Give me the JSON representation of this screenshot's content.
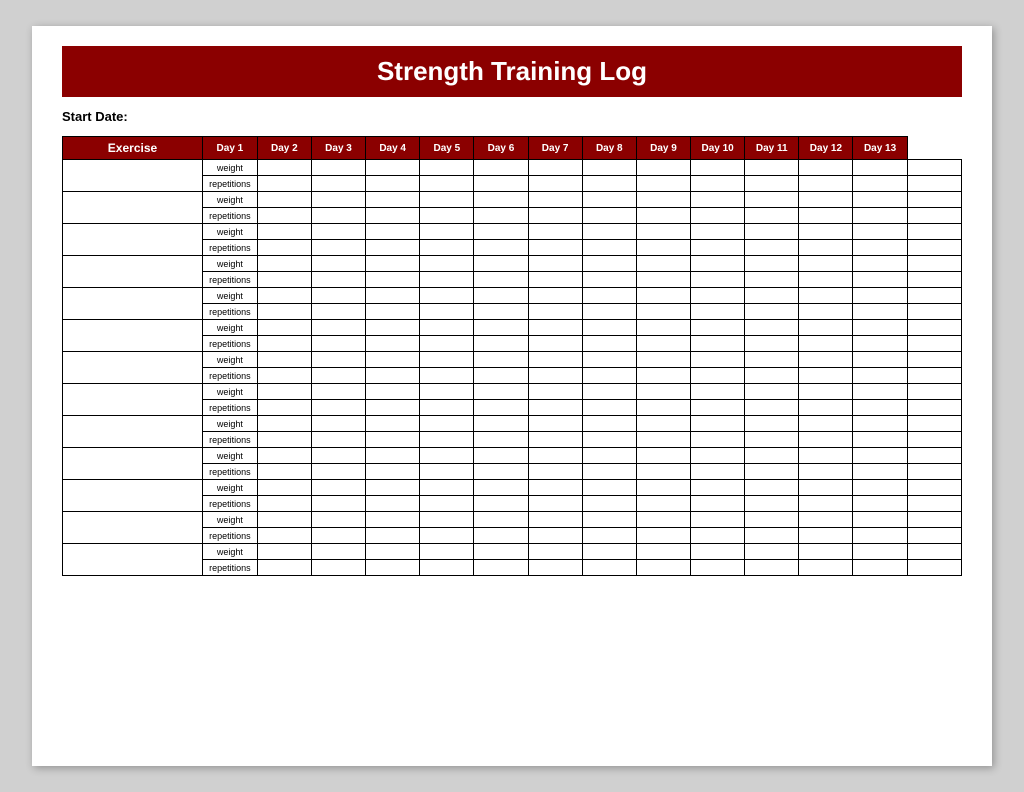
{
  "title": "Strength Training Log",
  "startDateLabel": "Start Date:",
  "header": {
    "exercise": "Exercise",
    "days": [
      "Day 1",
      "Day 2",
      "Day 3",
      "Day 4",
      "Day 5",
      "Day 6",
      "Day 7",
      "Day 8",
      "Day 9",
      "Day 10",
      "Day 11",
      "Day 12",
      "Day 13"
    ]
  },
  "rowLabels": {
    "weight": "weight",
    "repetitions": "repetitions"
  },
  "numExercises": 13
}
